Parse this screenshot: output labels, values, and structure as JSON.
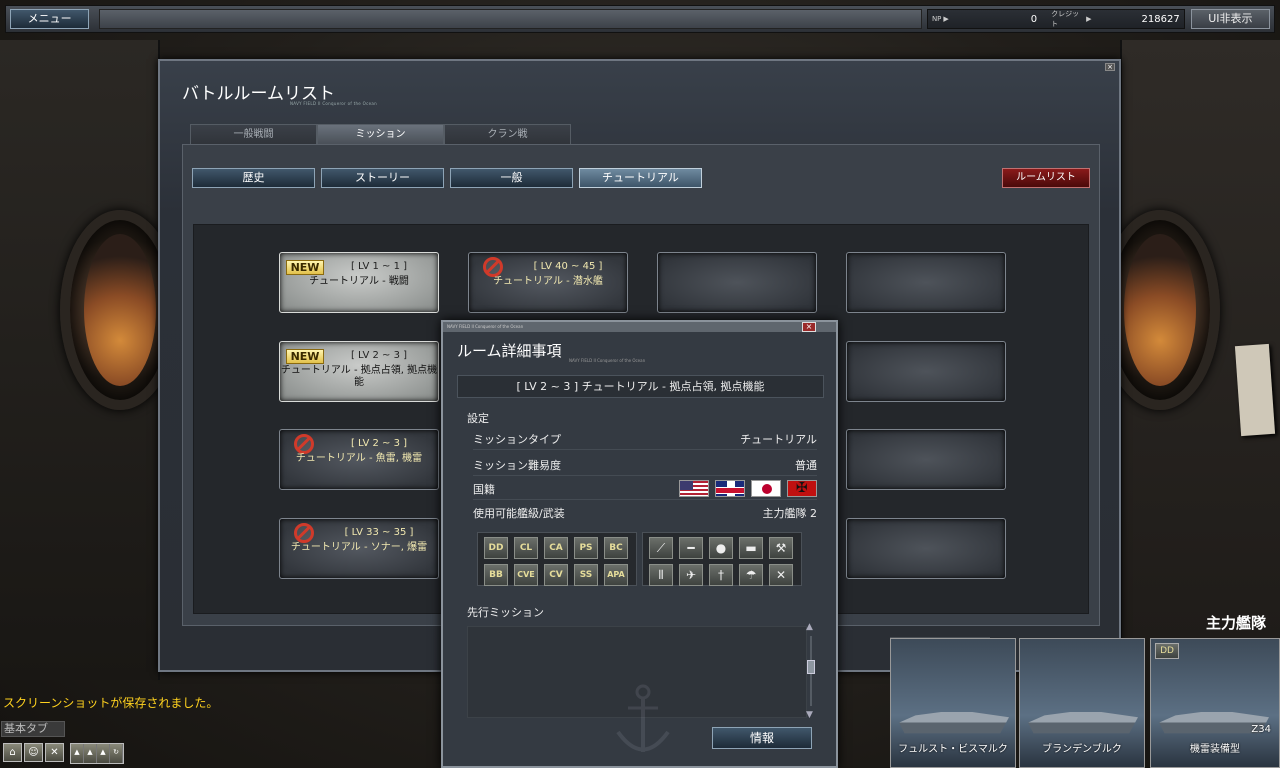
{
  "topbar": {
    "menu_label": "メニュー",
    "np_label": "NP",
    "np_value": "0",
    "credit_label": "クレジット",
    "credit_value": "218627",
    "ui_hide_label": "UI非表示"
  },
  "main": {
    "title": "バトルルームリスト",
    "subtitle": "NAVY FIELD II Conqueror of the Ocean",
    "tabs": [
      {
        "label": "一般戦闘",
        "active": false
      },
      {
        "label": "ミッション",
        "active": true
      },
      {
        "label": "クラン戦",
        "active": false
      }
    ],
    "filters": [
      {
        "label": "歴史",
        "active": false
      },
      {
        "label": "ストーリー",
        "active": false
      },
      {
        "label": "一般",
        "active": false
      },
      {
        "label": "チュートリアル",
        "active": true
      }
    ],
    "roomlist_label": "ルームリスト",
    "cards": [
      {
        "badge": "NEW",
        "level": "[ LV 1 ~ 1 ]",
        "name": "チュートリアル - 戦闘",
        "style": "light"
      },
      {
        "badge": "no",
        "level": "[ LV 40 ~ 45 ]",
        "name": "チュートリアル - 潜水艦",
        "style": "dark"
      },
      {
        "badge": "",
        "level": "",
        "name": "",
        "style": "empty"
      },
      {
        "badge": "",
        "level": "",
        "name": "",
        "style": "empty"
      },
      {
        "badge": "NEW",
        "level": "[ LV 2 ~ 3 ]",
        "name": "チュートリアル - 拠点占領, 拠点機能",
        "style": "light"
      },
      {
        "badge": "no",
        "level": "[ LV 2 ~ 3 ]",
        "name": "チュートリアル - 魚雷, 機雷",
        "style": "dark"
      },
      {
        "badge": "no",
        "level": "[ LV 33 ~ 35 ]",
        "name": "チュートリアル - ソナー, 爆雷",
        "style": "dark"
      }
    ]
  },
  "dialog": {
    "header_text": "NAVY FIELD II Conqueror of the Ocean",
    "title": "ルーム詳細事項",
    "subtitle": "NAVY FIELD II Conqueror of the Ocean",
    "room_name": "[ LV 2 ~ 3 ] チュートリアル - 拠点占領, 拠点機能",
    "settings_label": "設定",
    "rows": [
      {
        "label": "ミッションタイプ",
        "value": "チュートリアル"
      },
      {
        "label": "ミッション難易度",
        "value": "普通"
      },
      {
        "label": "国籍",
        "value": ""
      },
      {
        "label": "使用可能艦級/武装",
        "value": "主力艦隊 2"
      }
    ],
    "nations": [
      "us-flag",
      "uk-flag",
      "japan-flag",
      "germany-flag"
    ],
    "ship_classes": [
      "DD",
      "CL",
      "CA",
      "PS",
      "BC",
      "BB",
      "CVE",
      "CV",
      "SS",
      "APA"
    ],
    "weapons": [
      "torpedo-icon",
      "gun-icon",
      "depth-charge-icon",
      "mine-icon",
      "repair-icon",
      "rocket-icon",
      "aircraft-icon",
      "wrench-icon",
      "parachute-icon",
      "scout-plane-icon"
    ],
    "prev_mission_label": "先行ミッション",
    "info_button": "情報"
  },
  "bottom_left": {
    "notice": "スクリーンショットが保存されました。",
    "chat_tab": "基本タブ"
  },
  "fleet": {
    "title": "主力艦隊",
    "ships": [
      {
        "name": "フュルスト・ビスマルク",
        "code": "",
        "badge": ""
      },
      {
        "name": "ブランデンブルク",
        "code": "",
        "badge": ""
      },
      {
        "name": "機雷装備型",
        "code": "Z34",
        "badge": "DD"
      }
    ]
  }
}
